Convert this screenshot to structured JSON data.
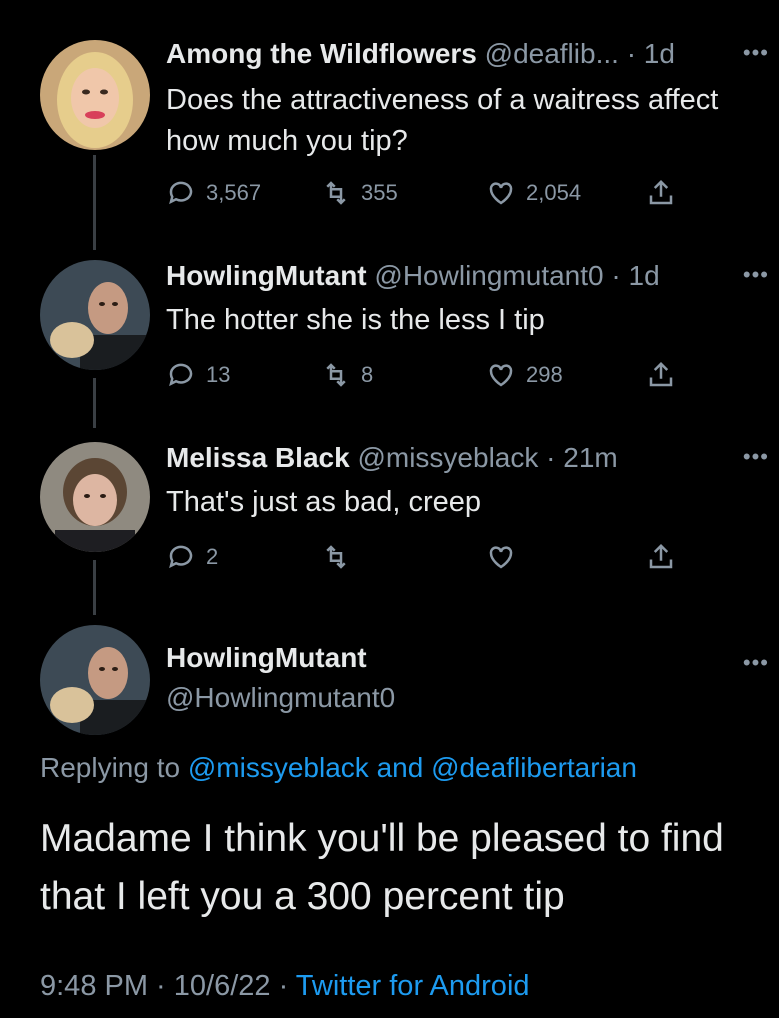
{
  "tweets": [
    {
      "name": "Among the Wildflowers",
      "handle": "@deaflib...",
      "time": "· 1d",
      "text": "Does the attractiveness of a waitress affect how much you tip?",
      "replies": "3,567",
      "retweets": "355",
      "likes": "2,054"
    },
    {
      "name": "HowlingMutant",
      "handle": "@Howlingmutant0",
      "time": "· 1d",
      "text": "The hotter she is the less I tip",
      "replies": "13",
      "retweets": "8",
      "likes": "298"
    },
    {
      "name": "Melissa Black",
      "handle": "@missyeblack",
      "time": "· 21m",
      "text": "That's just as bad, creep",
      "replies": "2",
      "retweets": "",
      "likes": ""
    }
  ],
  "main": {
    "name": "HowlingMutant",
    "handle": "@Howlingmutant0",
    "replying_prefix": "Replying to",
    "reply_to_1": "@missyeblack",
    "reply_and": "and",
    "reply_to_2": "@deaflibertarian",
    "text": "Madame I think you'll be pleased to find that I left you a 300 percent tip",
    "time": "9:48 PM · 10/6/22 ·",
    "source": "Twitter for Android"
  },
  "icons": {
    "more": "more-dots-icon",
    "reply": "reply-icon",
    "retweet": "retweet-icon",
    "like": "like-icon",
    "share": "share-icon"
  },
  "colors": {
    "background": "#000000",
    "text": "#e7e9ea",
    "muted": "#8b98a5",
    "link": "#1d9bf0"
  }
}
